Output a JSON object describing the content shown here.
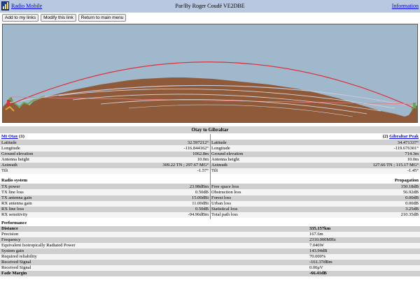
{
  "header": {
    "app_link": "Radio Mobile",
    "author": "Par/By Roger Coudé VE2DBE",
    "info_link": "Information"
  },
  "buttons": {
    "add": "Add to my links",
    "modify": "Modify this link",
    "return": "Return to main menu"
  },
  "link_title": "Otay to Gibraltar",
  "site1": {
    "name": "Mt Otay",
    "index": "(1)",
    "latitude": "32.597212°",
    "longitude": "-116.844162°",
    "ground_elevation": "1062.8m",
    "antenna_height": "10.0m",
    "azimuth": "309.22 TN ; 297.67 MG°",
    "tilt": "-1.57°"
  },
  "site2": {
    "name": "Gibraltar Peak",
    "index": "(2)",
    "latitude": "34.471337°",
    "longitude": "-119.676301°",
    "ground_elevation": "714.3m",
    "antenna_height": "10.0m",
    "azimuth": "127.66 TN ; 115.17 MG°",
    "tilt": "-1.45°"
  },
  "labels": {
    "latitude": "Latitude",
    "longitude": "Longitude",
    "ground_elevation": "Ground elevation",
    "antenna_height": "Antenna height",
    "azimuth": "Azimuth",
    "tilt": "Tilt"
  },
  "radio_system": {
    "header": "Radio system",
    "rows": [
      {
        "label": "TX power",
        "value": "23.98dBm"
      },
      {
        "label": "TX line loss",
        "value": "0.50dB"
      },
      {
        "label": "TX antenna gain",
        "value": "15.00dBi"
      },
      {
        "label": "RX antenna gain",
        "value": "11.00dBi"
      },
      {
        "label": "RX line loss",
        "value": "0.50dB"
      },
      {
        "label": "RX sensitivity",
        "value": "-94.96dBm"
      }
    ]
  },
  "propagation": {
    "header": "Propagation",
    "rows": [
      {
        "label": "Free space loss",
        "value": "150.18dB"
      },
      {
        "label": "Obstruction loss",
        "value": "56.92dB"
      },
      {
        "label": "Forest loss",
        "value": "0.00dB"
      },
      {
        "label": "Urban loss",
        "value": "0.00dB"
      },
      {
        "label": "Statistical loss",
        "value": "3.25dB"
      },
      {
        "label": "Total path loss",
        "value": "210.35dB"
      }
    ]
  },
  "performance": {
    "header": "Performance",
    "rows": [
      {
        "label": "Distance",
        "value": "335.157km",
        "bold": true
      },
      {
        "label": "Precision",
        "value": "167.6m",
        "bold": false
      },
      {
        "label": "Frequency",
        "value": "2310.000MHz",
        "bold": false
      },
      {
        "label": "Equivalent Isotropically Radiated Power",
        "value": "7.046W",
        "bold": false
      },
      {
        "label": "System gain",
        "value": "143.94dB",
        "bold": false
      },
      {
        "label": "Required reliability",
        "value": "70.000%",
        "bold": false
      },
      {
        "label": "Received Signal",
        "value": "-161.37dBm",
        "bold": false
      },
      {
        "label": "Received Signal",
        "value": "0.00μV",
        "bold": false
      },
      {
        "label": "Fade Margin",
        "value": "-66.41dB",
        "bold": true
      }
    ]
  },
  "colors": {
    "sky": "#9fb8cc",
    "terrain": "#8f5a3a",
    "path_line": "#e0303a",
    "forest": "#6aa84f",
    "header_bar": "#b8c8e0"
  }
}
